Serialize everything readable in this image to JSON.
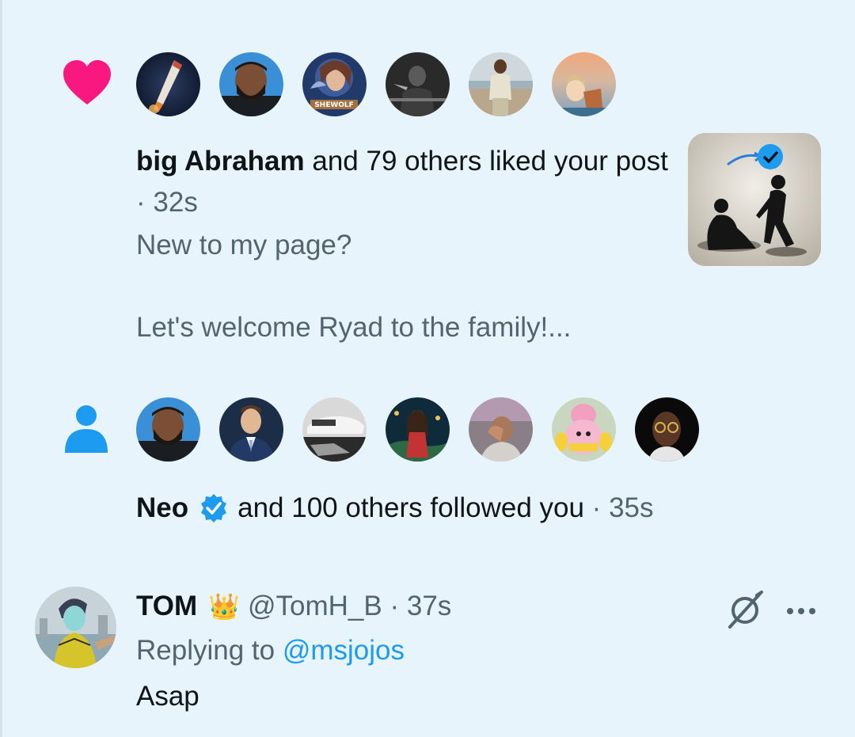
{
  "notifications": [
    {
      "type": "like",
      "icon": "heart-icon",
      "icon_color": "#f91880",
      "avatars": [
        "rocket-avatar",
        "man-beard-avatar",
        "shewolf-avatar",
        "boy-bw-avatar",
        "beach-man-avatar",
        "sunset-avatar"
      ],
      "shewolf_label": "SHEWOLF",
      "actor": "big Abraham",
      "action": "and 79 others liked your post",
      "separator": "·",
      "time": "32s",
      "preview_line1": "New to my page?",
      "preview_line2": "Let's welcome Ryad to the family!..."
    },
    {
      "type": "follow",
      "icon": "person-icon",
      "icon_color": "#1d9bf0",
      "avatars": [
        "man-beard-avatar",
        "suit-man-avatar",
        "car-avatar",
        "woman-avatar",
        "man-hand-avatar",
        "toy-avatar",
        "glasses-man-avatar"
      ],
      "actor": "Neo",
      "verified": true,
      "action": "and 100 others followed you",
      "separator": "·",
      "time": "35s"
    }
  ],
  "reply": {
    "name": "TOM",
    "badge_emoji": "👑",
    "handle": "@TomH_B",
    "separator": "·",
    "time": "37s",
    "replying_prefix": "Replying to",
    "replying_handle": "@msjojos",
    "body": "Asap"
  },
  "colors": {
    "background": "#e8f4fb",
    "text": "#0f1419",
    "muted": "#536471",
    "accent": "#1d9bf0",
    "like": "#f91880"
  }
}
